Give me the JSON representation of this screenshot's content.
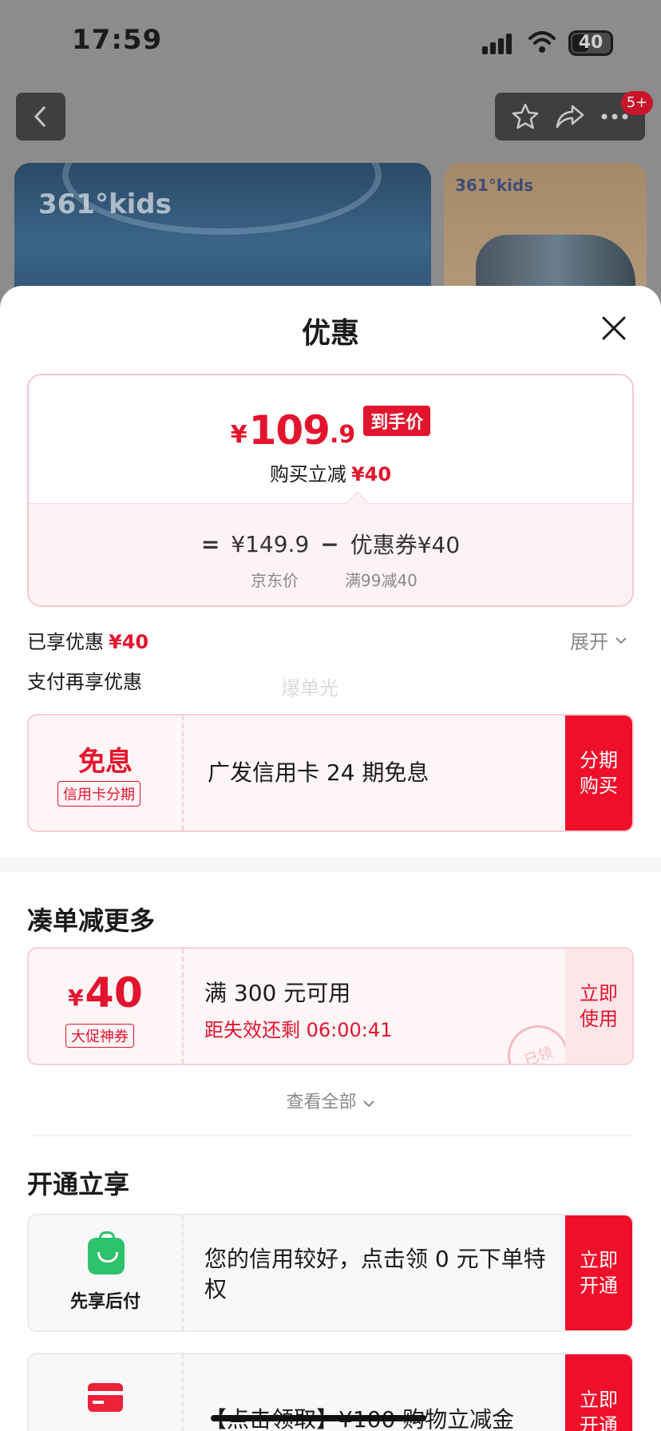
{
  "status_bar": {
    "time": "17:59",
    "battery": "40"
  },
  "header": {
    "badge": "5+"
  },
  "banners": {
    "brand_main": "361°kids",
    "brand_side": "361°kids"
  },
  "sheet": {
    "title": "优惠",
    "price_card": {
      "currency": "¥",
      "final_int": "109",
      "final_dec": ".9",
      "final_tag": "到手价",
      "reduce_label": "购买立减",
      "reduce_amount": "¥40",
      "eq": "=",
      "jd_price": "¥149.9",
      "minus": "−",
      "coupon_text": "优惠券¥40",
      "jd_price_label": "京东价",
      "coupon_rule": "满99减40"
    },
    "enjoyed_label": "已享优惠",
    "enjoyed_amount": "¥40",
    "expand_label": "展开",
    "pay_more_label": "支付再享优惠",
    "watermark": "爆单光",
    "installment": {
      "big": "免息",
      "tag": "信用卡分期",
      "text": "广发信用卡 24 期免息",
      "action": "分期\n购买"
    },
    "bundle_title": "凑单减更多",
    "coupon": {
      "currency": "¥",
      "amount": "40",
      "tag": "大促神券",
      "condition": "满 300 元可用",
      "countdown": "距失效还剩 06:00:41",
      "stamp": "已领",
      "action": "立即\n使用"
    },
    "view_all": "查看全部",
    "open_title": "开通立享",
    "credit": {
      "label": "先享后付",
      "text": "您的信用较好，点击领 0 元下单特权",
      "action": "立即\n开通"
    },
    "card2": {
      "text": "【点击领取】¥100 购物立减金",
      "action": "立即\n开通"
    }
  }
}
